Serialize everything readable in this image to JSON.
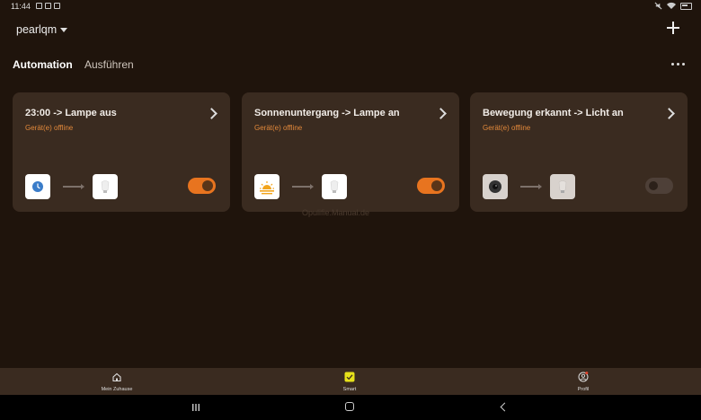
{
  "statusbar": {
    "time": "11:44"
  },
  "header": {
    "home_name": "pearlqm"
  },
  "tabs": [
    {
      "label": "Automation",
      "active": true
    },
    {
      "label": "Ausführen",
      "active": false
    }
  ],
  "cards": [
    {
      "title": "23:00 -> Lampe aus",
      "status": "Gerät(e) offline",
      "enabled": true,
      "condition_icon": "clock-icon",
      "action_icon": "bulb-icon"
    },
    {
      "title": "Sonnenuntergang -> Lampe an",
      "status": "Gerät(e) offline",
      "enabled": true,
      "condition_icon": "sunset-icon",
      "action_icon": "bulb-icon"
    },
    {
      "title": "Bewegung erkannt -> Licht an",
      "status": "Gerät(e) offline",
      "enabled": false,
      "condition_icon": "camera-icon",
      "action_icon": "bulb-icon"
    }
  ],
  "watermark": "Opulifie.Manual.de",
  "bottom_nav": [
    {
      "label": "Mein Zuhause",
      "icon": "home-icon"
    },
    {
      "label": "Smart",
      "icon": "smart-icon"
    },
    {
      "label": "Profil",
      "icon": "profile-icon"
    }
  ],
  "colors": {
    "background": "#1f140c",
    "card": "#3a2b20",
    "accent": "#e8741f",
    "offline": "#e3893b",
    "smart": "#e6e11a"
  }
}
